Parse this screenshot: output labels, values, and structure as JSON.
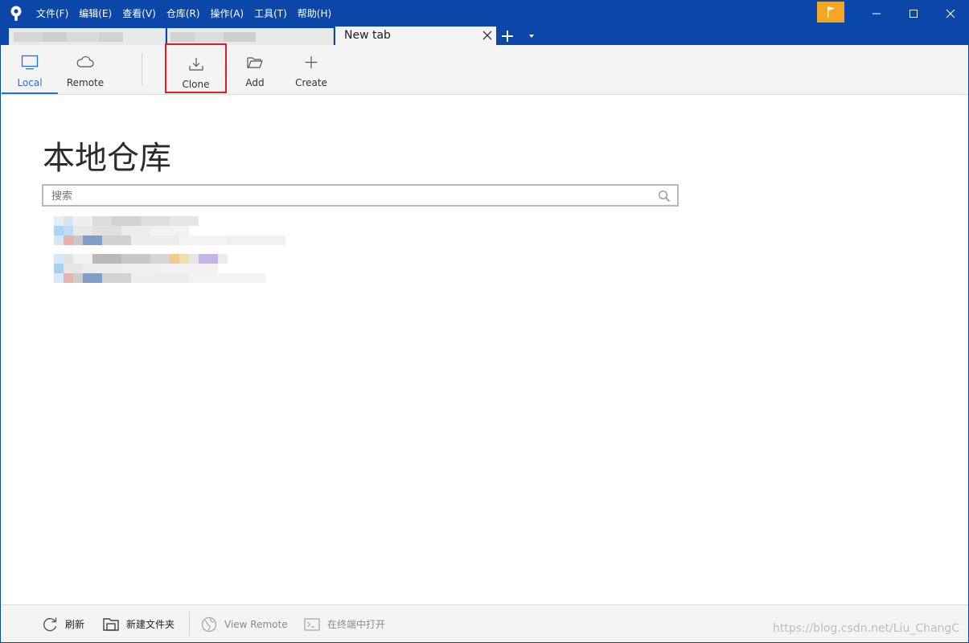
{
  "app": {
    "logo_icon": "sourcetree-logo-icon"
  },
  "menu": {
    "items": [
      {
        "label": "文件(F)"
      },
      {
        "label": "编辑(E)"
      },
      {
        "label": "查看(V)"
      },
      {
        "label": "仓库(R)"
      },
      {
        "label": "操作(A)"
      },
      {
        "label": "工具(T)"
      },
      {
        "label": "帮助(H)"
      }
    ]
  },
  "window_controls": {
    "flag_icon": "flag-icon",
    "minimize_icon": "minimize-icon",
    "maximize_icon": "maximize-icon",
    "close_icon": "close-icon"
  },
  "tabs": {
    "active": {
      "label": "New tab"
    },
    "add_icon": "plus-icon",
    "dropdown_icon": "chevron-down-icon"
  },
  "toolbar": {
    "local": {
      "label": "Local",
      "icon": "monitor-icon"
    },
    "remote": {
      "label": "Remote",
      "icon": "cloud-icon"
    },
    "clone": {
      "label": "Clone",
      "icon": "download-icon"
    },
    "add": {
      "label": "Add",
      "icon": "folder-open-icon"
    },
    "create": {
      "label": "Create",
      "icon": "plus-icon"
    }
  },
  "main": {
    "title": "本地仓库",
    "search": {
      "placeholder": "搜索",
      "value": ""
    }
  },
  "statusbar": {
    "refresh": {
      "label": "刷新",
      "icon": "refresh-icon"
    },
    "new_folder": {
      "label": "新建文件夹",
      "icon": "new-folder-icon"
    },
    "view_remote": {
      "label": "View Remote",
      "icon": "globe-icon"
    },
    "open_terminal": {
      "label": "在终端中打开",
      "icon": "terminal-icon"
    }
  },
  "watermark": "https://blog.csdn.net/Liu_ChangC",
  "colors": {
    "titlebar": "#0a47a8",
    "accent": "#1a73e8",
    "highlight": "#e02020",
    "flag": "#f5a623"
  }
}
